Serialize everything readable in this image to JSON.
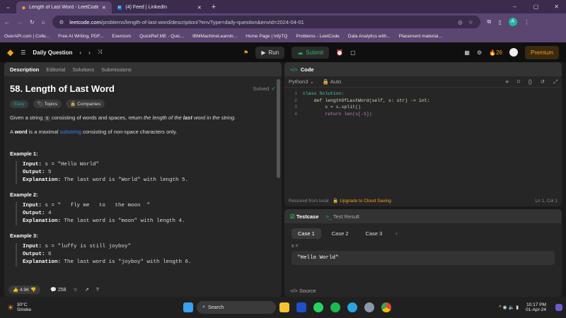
{
  "browser": {
    "tabs": [
      {
        "label": "Length of Last Word - LeetCode",
        "active": true
      },
      {
        "label": "(4) Feed | LinkedIn",
        "active": false
      }
    ],
    "url_domain": "leetcode.com",
    "url_path": "/problems/length-of-last-word/description/?envType=daily-question&envId=2024-04-01",
    "bookmarks": [
      "OverAPI.com | Colle...",
      "Free AI Writing, PDF...",
      "Exercism",
      "QuickRef.ME - Quic...",
      "IBMMachineLearnin...",
      "Home Page | InfyTQ",
      "Problems - LeetCode",
      "Data Analytics with...",
      "Placement material..."
    ]
  },
  "nav": {
    "title": "Daily Question",
    "run": "Run",
    "submit": "Submit",
    "streak": "26",
    "premium": "Premium"
  },
  "left": {
    "tabs": [
      "Description",
      "Editorial",
      "Solutions",
      "Submissions"
    ],
    "title": "58. Length of Last Word",
    "status": "Solved",
    "difficulty": "Easy",
    "topics": "Topics",
    "companies": "Companies",
    "desc1a": "Given a string ",
    "desc1var": "s",
    "desc1b": " consisting of words and spaces, return ",
    "desc1c": "the length of the ",
    "desc1d": "last",
    "desc1e": " word in the string.",
    "desc2a": "A ",
    "desc2b": "word",
    "desc2c": " is a maximal ",
    "desc2link": "substring",
    "desc2d": " consisting of non-space characters only.",
    "examples": [
      {
        "title": "Example 1:",
        "input": "s = \"Hello World\"",
        "output": "5",
        "explanation": "The last word is \"World\" with length 5."
      },
      {
        "title": "Example 2:",
        "input": "s = \"   fly me   to   the moon  \"",
        "output": "4",
        "explanation": "The last word is \"moon\" with length 4."
      },
      {
        "title": "Example 3:",
        "input": "s = \"luffy is still joyboy\"",
        "output": "6",
        "explanation": "The last word is \"joyboy\" with length 6."
      }
    ],
    "labels": {
      "input": "Input:",
      "output": "Output:",
      "explanation": "Explanation:"
    },
    "likes": "4.9K",
    "comments": "258"
  },
  "code": {
    "title": "Code",
    "language": "Python3",
    "mode": "Auto",
    "lines": [
      {
        "n": "1",
        "t": "class Solution:"
      },
      {
        "n": "2",
        "t": "    def lengthOfLastWord(self, s: str) -> int:"
      },
      {
        "n": "3",
        "t": "        s = s.split()"
      },
      {
        "n": "4",
        "t": "        return len(s[-1])"
      }
    ],
    "restored": "Restored from local",
    "upgrade": "Upgrade to Cloud Saving",
    "cursor": "Ln 1, Col 1"
  },
  "testcase": {
    "tab1": "Testcase",
    "tab2": "Test Result",
    "cases": [
      "Case 1",
      "Case 2",
      "Case 3"
    ],
    "var": "s =",
    "value": "\"Hello World\"",
    "source": "Source"
  },
  "taskbar": {
    "temp": "30°C",
    "weather": "Smoke",
    "search": "Search",
    "time": "10:17 PM",
    "date": "01-Apr-24"
  }
}
